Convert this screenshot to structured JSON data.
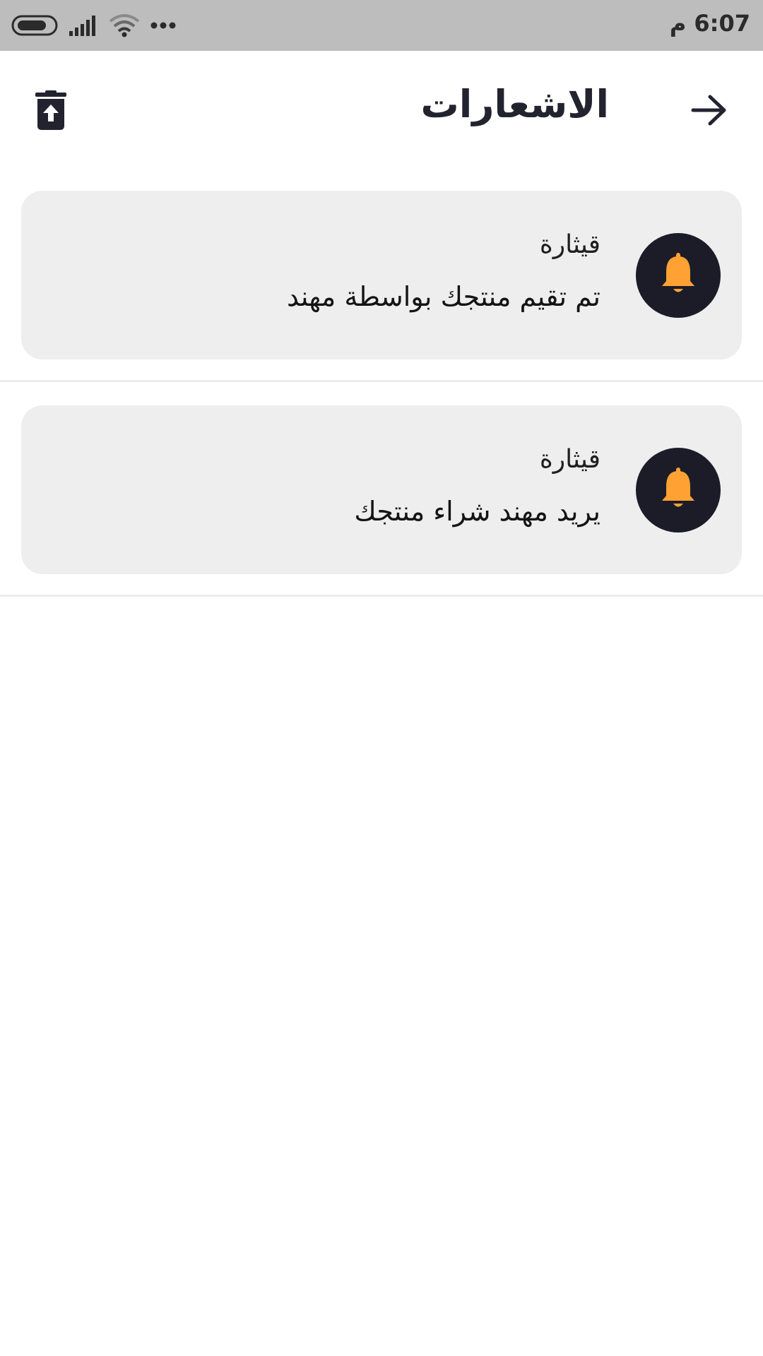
{
  "status_bar": {
    "time": "6:07 م"
  },
  "header": {
    "title": "الاشعارات",
    "back_icon": "arrow-right-icon",
    "delete_icon": "trash-restore-icon"
  },
  "notifications": [
    {
      "title": "قيثارة",
      "message": "تم تقيم منتجك بواسطة مهند",
      "icon": "bell-icon"
    },
    {
      "title": "قيثارة",
      "message": "يريد مهند شراء منتجك",
      "icon": "bell-icon"
    }
  ],
  "colors": {
    "status_bar_bg": "#bdbdbd",
    "card_bg": "#eeeeee",
    "badge_bg": "#1c1c28",
    "bell": "#ffa233",
    "title_text": "#22232f"
  }
}
